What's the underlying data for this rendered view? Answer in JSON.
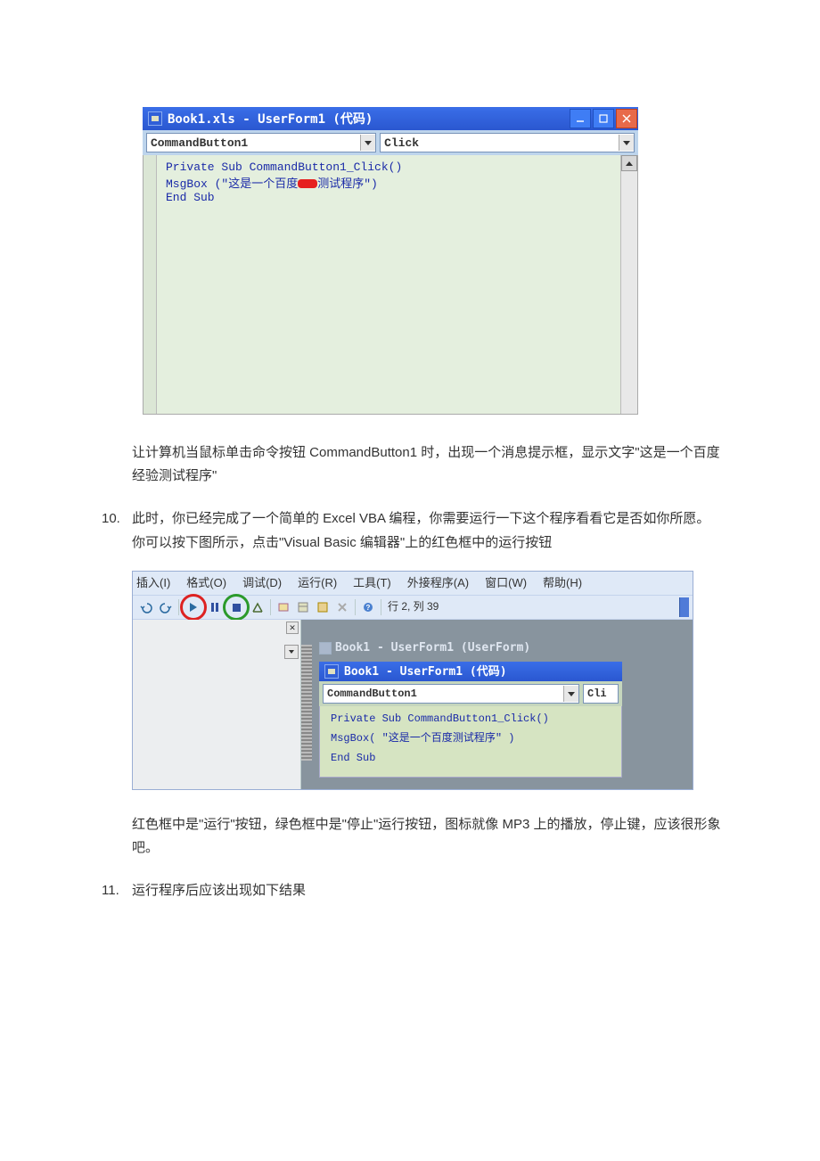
{
  "shot1": {
    "title": "Book1.xls - UserForm1 (代码)",
    "dd_left": "CommandButton1",
    "dd_right": "Click",
    "code_l1": "Private Sub CommandButton1_Click()",
    "code_l2a": "MsgBox (\"这是一个百度",
    "code_l2b": "测试程序\")",
    "code_l3": "End Sub"
  },
  "para1": "让计算机当鼠标单击命令按钮 CommandButton1 时，出现一个消息提示框，显示文字\"这是一个百度经验测试程序\"",
  "step10_num": "10.",
  "step10": "此时，你已经完成了一个简单的 Excel VBA 编程，你需要运行一下这个程序看看它是否如你所愿。你可以按下图所示，点击\"Visual Basic  编辑器\"上的红色框中的运行按钮",
  "shot2": {
    "menus": [
      "插入(I)",
      "格式(O)",
      "调试(D)",
      "运行(R)",
      "工具(T)",
      "外接程序(A)",
      "窗口(W)",
      "帮助(H)"
    ],
    "status": "行 2, 列 39",
    "design_tag": "Book1 - UserForm1 (UserForm)",
    "title": "Book1 - UserForm1 (代码)",
    "dd_left": "CommandButton1",
    "dd_right": "Cli",
    "code_l1": "Private Sub CommandButton1_Click()",
    "code_l2a": "MsgBox( \"这是一个百度",
    "code_l2b": "测试程序\" )",
    "code_l3": "End Sub"
  },
  "para2": "红色框中是\"运行\"按钮，绿色框中是\"停止\"运行按钮，图标就像 MP3 上的播放，停止键，应该很形象吧。",
  "step11_num": "11.",
  "step11": "运行程序后应该出现如下结果"
}
